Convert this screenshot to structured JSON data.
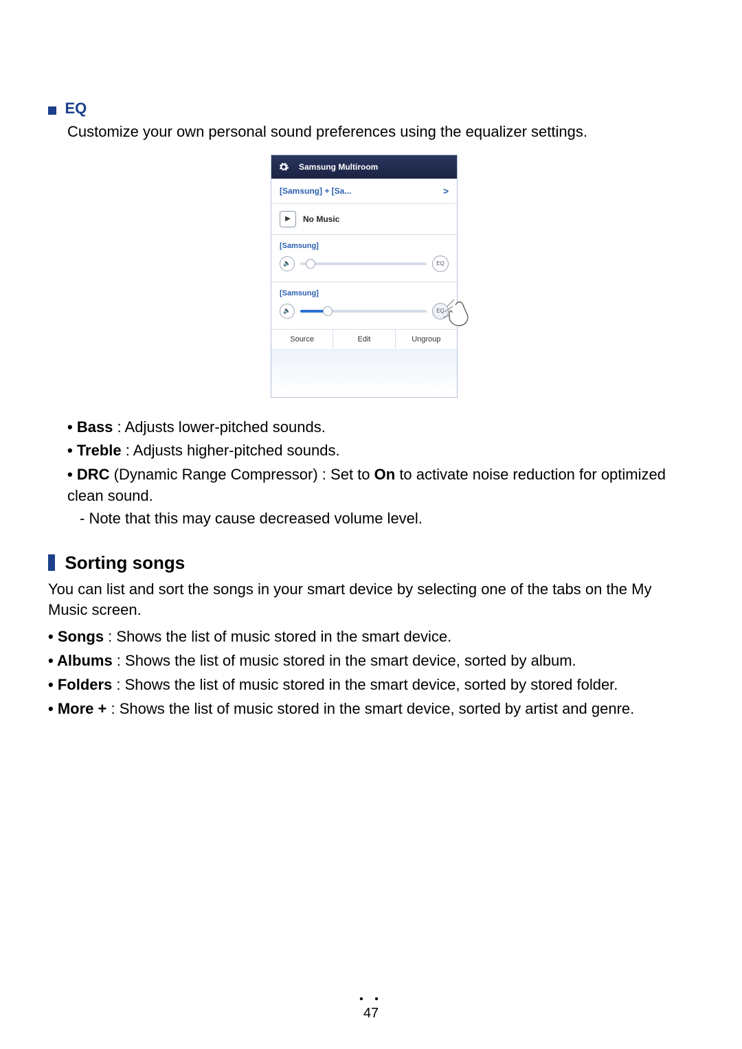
{
  "sections": {
    "eq": {
      "title": "EQ",
      "desc": "Customize your own personal sound preferences using the equalizer settings.",
      "bullets": {
        "bass": {
          "label": "Bass",
          "text": " : Adjusts lower-pitched sounds."
        },
        "treble": {
          "label": "Treble",
          "text": " : Adjusts higher-pitched sounds."
        },
        "drc": {
          "label": "DRC",
          "paren": " (Dynamic Range Compressor) : Set to ",
          "on": "On",
          "tail": " to activate noise reduction for optimized clean sound.",
          "note": "-  Note that this may cause decreased volume level."
        }
      }
    },
    "sorting": {
      "title": "Sorting songs",
      "desc": "You can list and sort the songs in your smart device by selecting one of the tabs on the My Music screen.",
      "bullets": {
        "songs": {
          "label": "Songs",
          "text": " : Shows the list of music stored in the smart device."
        },
        "albums": {
          "label": "Albums",
          "text": " : Shows the list of music stored in the smart device, sorted by album."
        },
        "folders": {
          "label": "Folders",
          "text": " : Shows the list of music stored in the smart device, sorted by stored folder."
        },
        "more": {
          "label": "More +",
          "text": " : Shows the list of music stored in the smart device, sorted by artist and genre."
        }
      }
    }
  },
  "phone": {
    "appTitle": "Samsung Multiroom",
    "roomLabel": "[Samsung] + [Sa...",
    "chevron": ">",
    "noMusic": "No Music",
    "playGlyph": "▶",
    "volGlyph": "🔈",
    "speaker1": {
      "name": "[Samsung]",
      "eq": "EQ"
    },
    "speaker2": {
      "name": "[Samsung]",
      "eq": "EQ"
    },
    "buttons": {
      "source": "Source",
      "edit": "Edit",
      "ungroup": "Ungroup"
    }
  },
  "pageNumber": "47"
}
